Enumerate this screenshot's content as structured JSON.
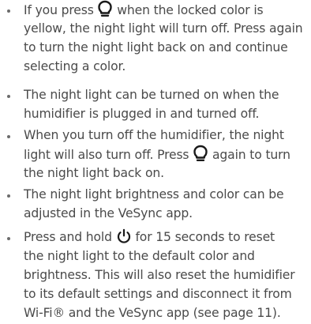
{
  "bullets": [
    {
      "lines": [
        [
          "If you press ",
          {
            "icon": "bulb-icon"
          },
          " when the locked color is"
        ],
        [
          "yellow, the night light will turn off. Press again"
        ],
        [
          "to turn the night light back on and continue"
        ],
        [
          "selecting a color."
        ]
      ]
    },
    {
      "lines": [
        [
          "The night light can be turned on when the"
        ],
        [
          "humidifier is plugged in and turned off."
        ]
      ]
    },
    {
      "lines": [
        [
          "When you turn off the humidifier, the night"
        ],
        [
          "light will also turn off. Press ",
          {
            "icon": "bulb-icon"
          },
          " again to turn"
        ],
        [
          "the night light back on."
        ]
      ]
    },
    {
      "lines": [
        [
          "The night light brightness and color can be"
        ],
        [
          "adjusted in the VeSync app."
        ]
      ]
    },
    {
      "lines": [
        [
          "Press and hold  ",
          {
            "icon": "power-icon"
          },
          "  for 15 seconds to reset"
        ],
        [
          "the night light to the default color and"
        ],
        [
          "brightness. This will also reset the humidifier"
        ],
        [
          "to its default settings and disconnect it from"
        ],
        [
          "Wi-Fi® and the VeSync app  (see page 11)."
        ]
      ]
    }
  ],
  "colors": {
    "text": "#4a4a4a",
    "bullet": "#6b6b6b",
    "icon": "#1a1a1a"
  }
}
